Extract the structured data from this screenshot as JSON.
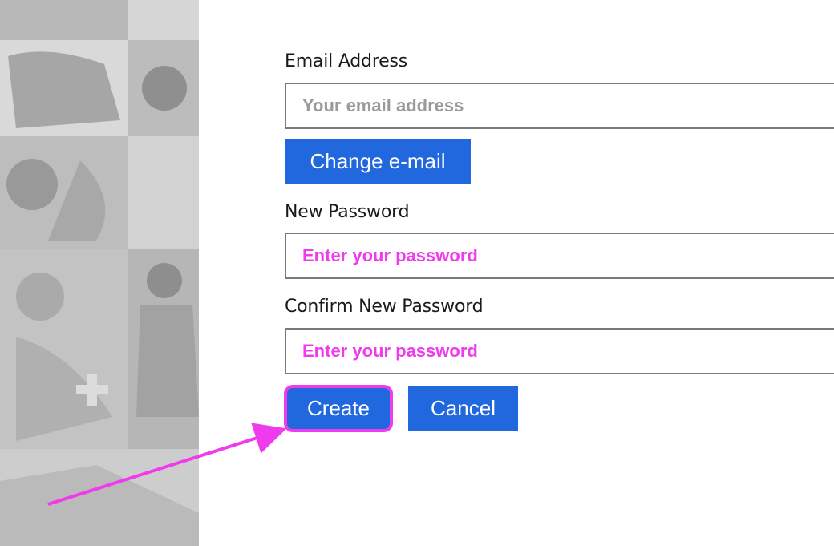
{
  "form": {
    "email_label": "Email Address",
    "email_placeholder": "Your email address",
    "change_email_label": "Change e-mail",
    "new_password_label": "New Password",
    "new_password_placeholder": "Enter your password",
    "confirm_password_label": "Confirm New Password",
    "confirm_password_placeholder": "Enter your password",
    "create_label": "Create",
    "cancel_label": "Cancel"
  },
  "colors": {
    "button": "#2167de",
    "annotation": "#ef3bed",
    "placeholder_gray": "#9a9a9a"
  },
  "icons": {
    "annotation": "arrow-annotation-icon"
  }
}
